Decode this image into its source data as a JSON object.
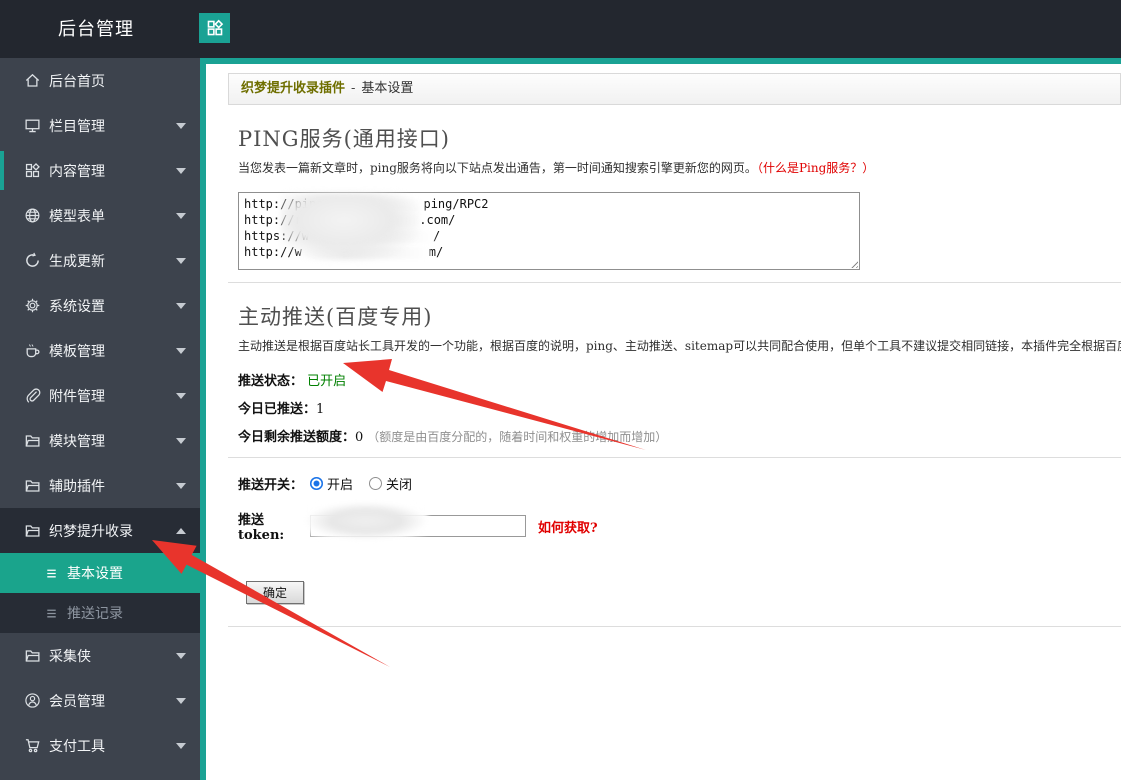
{
  "topbar": {
    "title": "后台管理",
    "app_icon": "modules-grid-icon"
  },
  "sidebar": {
    "items": [
      {
        "label": "后台首页",
        "icon": "home-icon"
      },
      {
        "label": "栏目管理",
        "icon": "monitor-icon",
        "chevron": "down"
      },
      {
        "label": "内容管理",
        "icon": "grid-icon",
        "chevron": "down",
        "accent": true
      },
      {
        "label": "模型表单",
        "icon": "globe-icon",
        "chevron": "down"
      },
      {
        "label": "生成更新",
        "icon": "refresh-icon",
        "chevron": "down"
      },
      {
        "label": "系统设置",
        "icon": "gear-icon",
        "chevron": "down"
      },
      {
        "label": "模板管理",
        "icon": "cup-icon",
        "chevron": "down"
      },
      {
        "label": "附件管理",
        "icon": "paperclip-icon",
        "chevron": "down"
      },
      {
        "label": "模块管理",
        "icon": "folder-icon",
        "chevron": "down"
      },
      {
        "label": "辅助插件",
        "icon": "folder-icon",
        "chevron": "down"
      },
      {
        "label": "织梦提升收录",
        "icon": "folder-icon",
        "chevron": "up",
        "expanded": true
      },
      {
        "label": "基本设置",
        "icon": "list-icon",
        "submenu": true,
        "active": true
      },
      {
        "label": "推送记录",
        "icon": "list-icon",
        "submenu": true
      },
      {
        "label": "采集侠",
        "icon": "folder-icon",
        "chevron": "down"
      },
      {
        "label": "会员管理",
        "icon": "user-icon",
        "chevron": "down"
      },
      {
        "label": "支付工具",
        "icon": "cart-icon",
        "chevron": "down"
      }
    ]
  },
  "page_header": {
    "plugin_name": "织梦提升收录插件",
    "separator": "-",
    "page_name": "基本设置"
  },
  "ping": {
    "title": "PING服务(通用接口)",
    "desc": "当您发表一篇新文章时，ping服务将向以下站点发出通告，第一时间通知搜索引擎更新您的网页。",
    "help_link": "（什么是Ping服务？）",
    "lines": [
      {
        "pre": "http://ping",
        "post": "ping/RPC2"
      },
      {
        "pre": "http://rpc",
        "post": ".com/"
      },
      {
        "pre": "https://w",
        "post": "/"
      },
      {
        "pre": "http://w",
        "post": "m/"
      }
    ]
  },
  "push": {
    "title": "主动推送(百度专用)",
    "desc": "主动推送是根据百度站长工具开发的一个功能，根据百度的说明，ping、主动推送、sitemap可以共同配合使用，但单个工具不建议提交相同链接，本插件完全根据百度",
    "status": {
      "state_label": "推送状态：",
      "state_value": "已开启",
      "today_label": "今日已推送：",
      "today_value": "1",
      "quota_label": "今日剩余推送额度：",
      "quota_value": "0",
      "quota_note": "（额度是由百度分配的，随着时间和权重的增加而增加）"
    },
    "form": {
      "switch_label": "推送开关：",
      "radio_on": "开启",
      "radio_off": "关闭",
      "selected": "开启",
      "token_label": "推送token:",
      "token_value": "",
      "token_help": "如何获取?",
      "submit_label": "确定"
    }
  },
  "colors": {
    "teal": "#1aa294",
    "arrow_red": "#e8342c",
    "link_red": "#e00000",
    "status_green": "#008000",
    "title_olive": "#6f6f00"
  }
}
